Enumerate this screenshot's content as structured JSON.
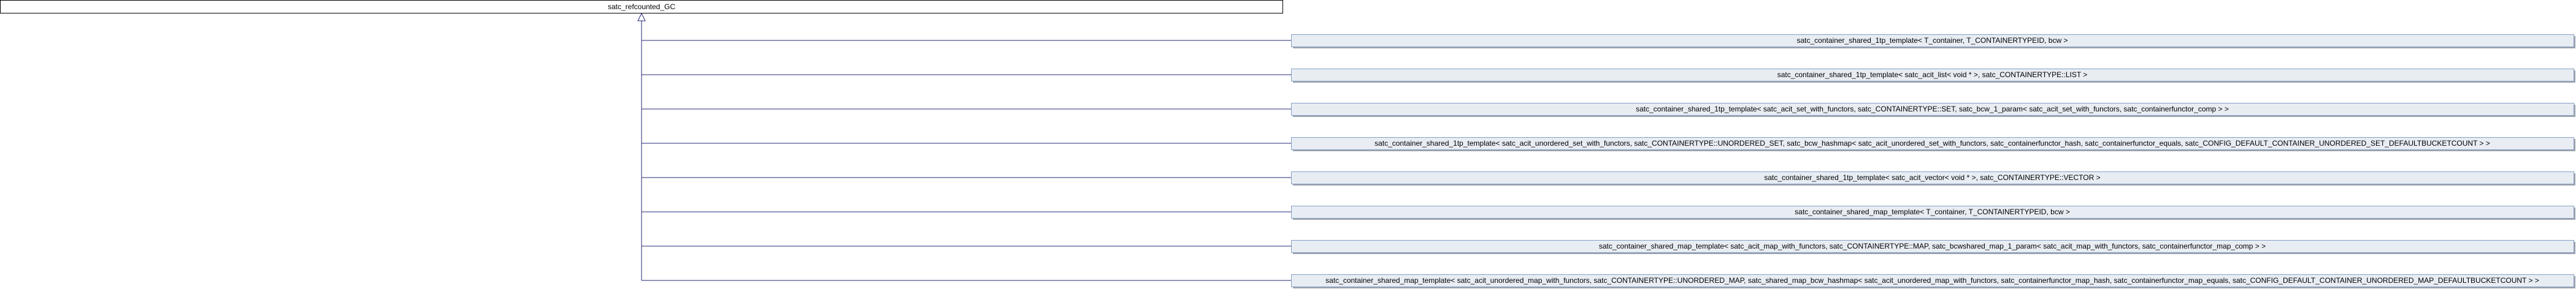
{
  "base_class": {
    "name": "satc_refcounted_GC",
    "fill": "#ffffff",
    "border": "#000000"
  },
  "derived_classes": [
    {
      "name": "satc_container_shared_1tp_template< T_container, T_CONTAINERTYPEID, bcw >"
    },
    {
      "name": "satc_container_shared_1tp_template< satc_acit_list< void * >, satc_CONTAINERTYPE::LIST >"
    },
    {
      "name": "satc_container_shared_1tp_template< satc_acit_set_with_functors, satc_CONTAINERTYPE::SET, satc_bcw_1_param< satc_acit_set_with_functors, satc_containerfunctor_comp > >"
    },
    {
      "name": "satc_container_shared_1tp_template< satc_acit_unordered_set_with_functors, satc_CONTAINERTYPE::UNORDERED_SET, satc_bcw_hashmap< satc_acit_unordered_set_with_functors, satc_containerfunctor_hash, satc_containerfunctor_equals, satc_CONFIG_DEFAULT_CONTAINER_UNORDERED_SET_DEFAULTBUCKETCOUNT > >"
    },
    {
      "name": "satc_container_shared_1tp_template< satc_acit_vector< void * >, satc_CONTAINERTYPE::VECTOR >"
    },
    {
      "name": "satc_container_shared_map_template< T_container, T_CONTAINERTYPEID, bcw >"
    },
    {
      "name": "satc_container_shared_map_template< satc_acit_map_with_functors, satc_CONTAINERTYPE::MAP, satc_bcwshared_map_1_param< satc_acit_map_with_functors, satc_containerfunctor_map_comp > >"
    },
    {
      "name": "satc_container_shared_map_template< satc_acit_unordered_map_with_functors, satc_CONTAINERTYPE::UNORDERED_MAP, satc_shared_map_bcw_hashmap< satc_acit_unordered_map_with_functors, satc_containerfunctor_map_hash, satc_containerfunctor_map_equals, satc_CONFIG_DEFAULT_CONTAINER_UNORDERED_MAP_DEFAULTBUCKETCOUNT > >"
    }
  ],
  "colors": {
    "derived_fill": "#e8edf3",
    "derived_border": "#84a0c4",
    "edge": "#25277a",
    "shadow": "#9ea3ad"
  }
}
